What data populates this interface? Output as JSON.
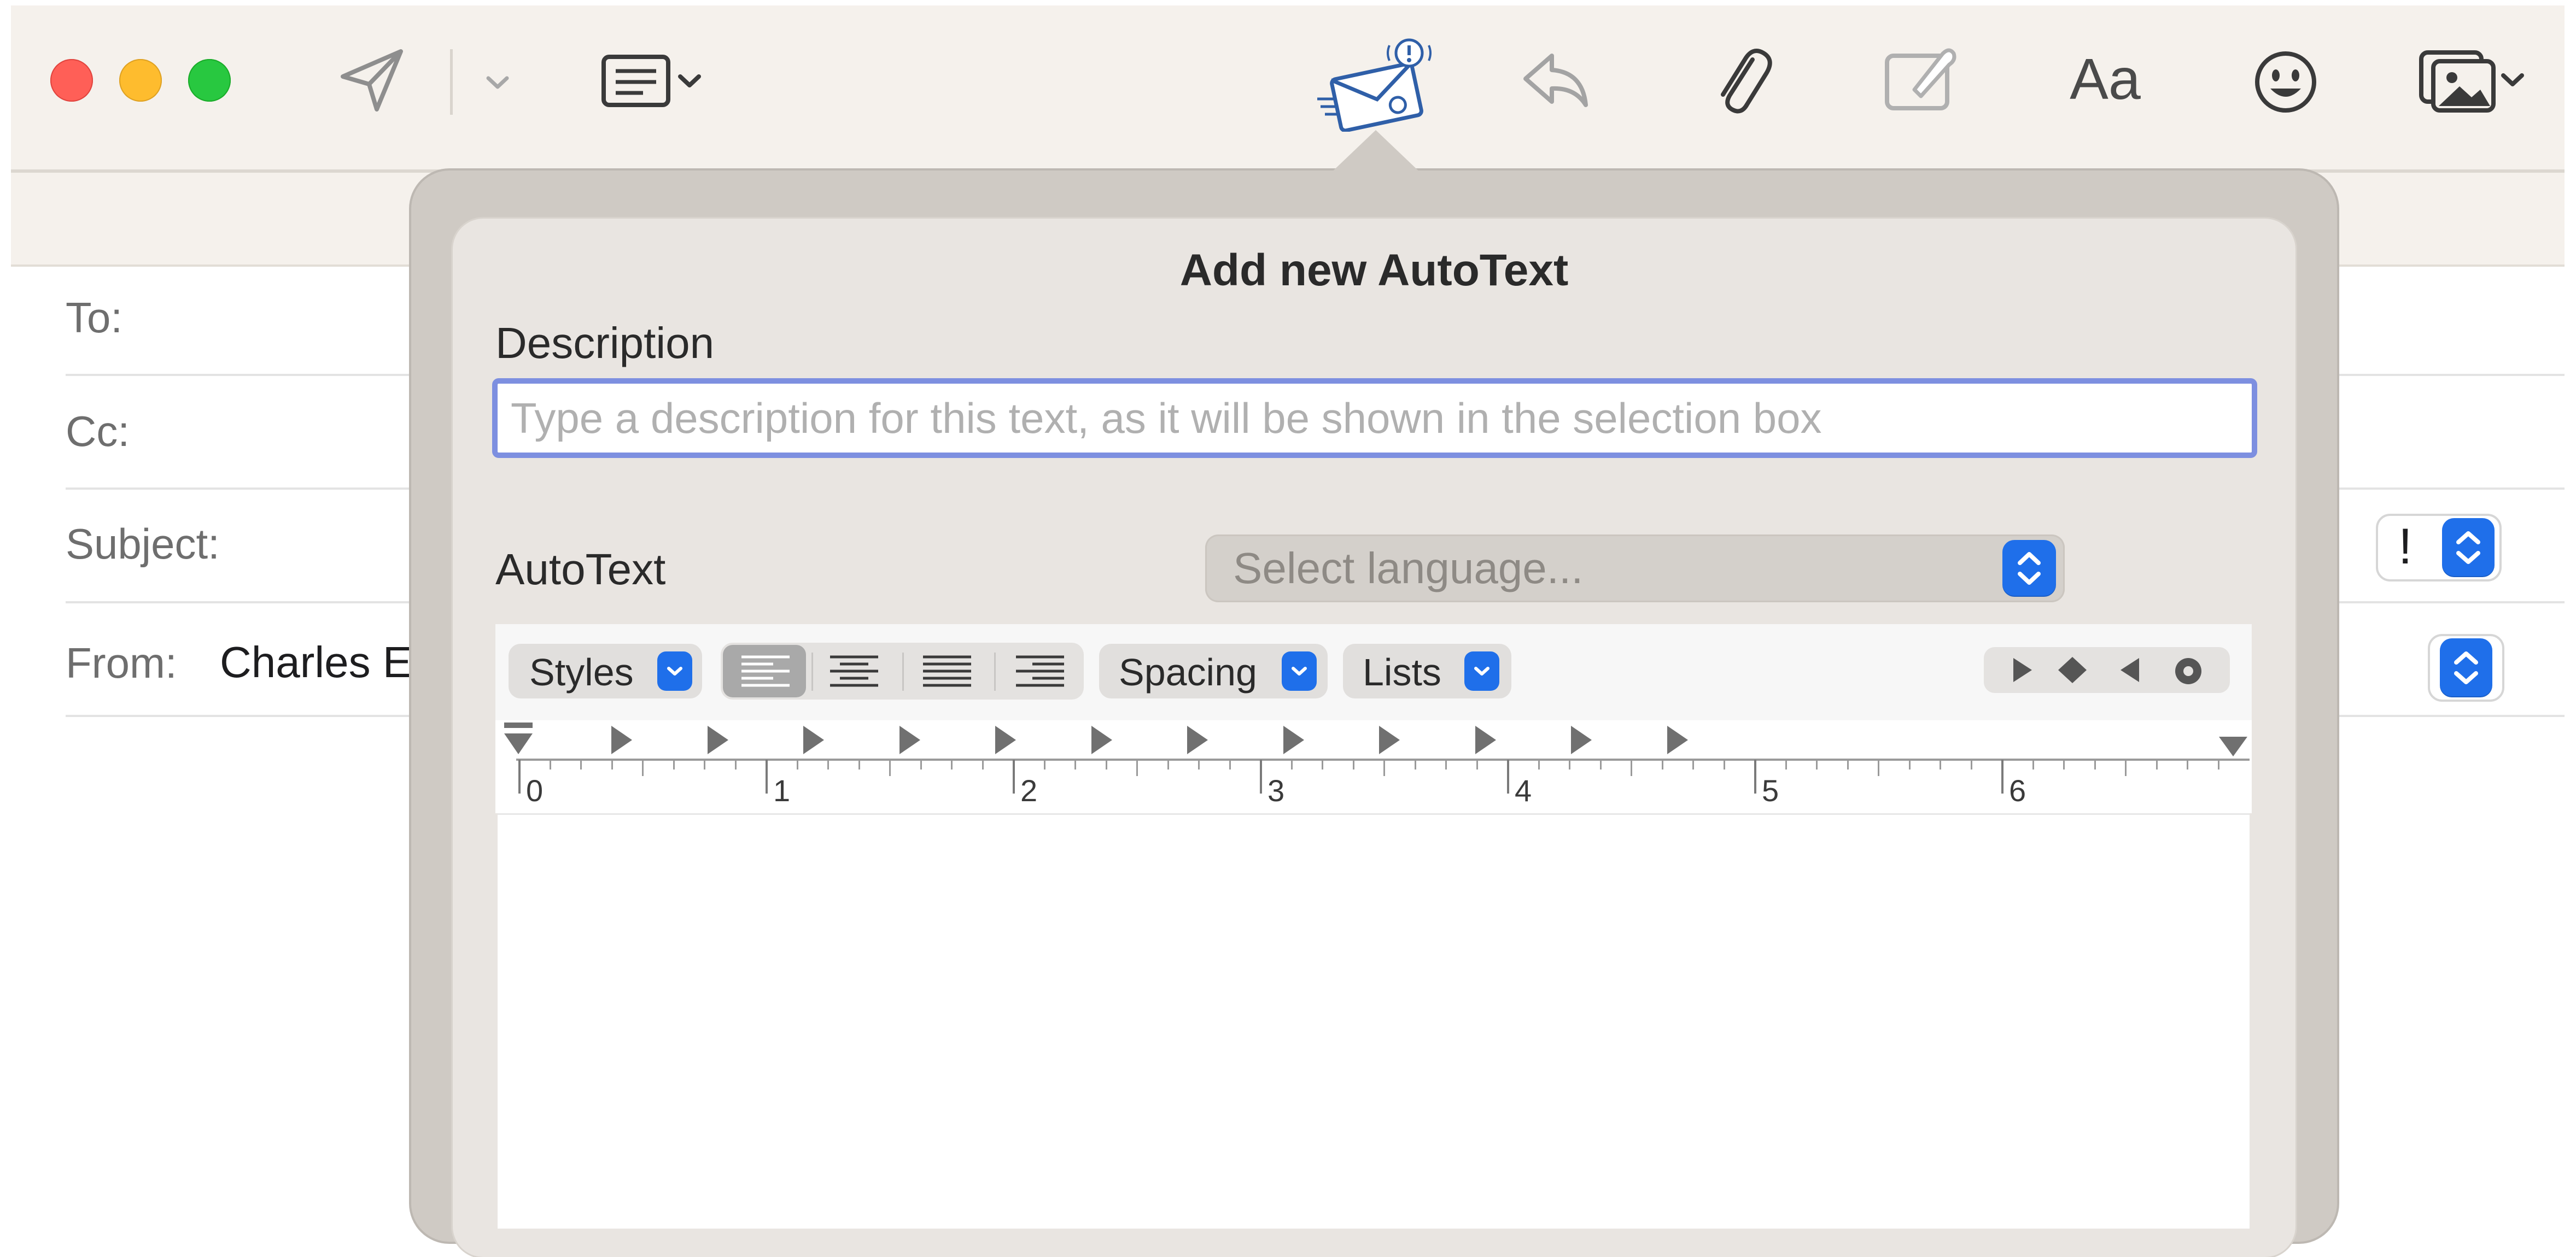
{
  "icons": {
    "send": "send-icon",
    "chevron": "chevron-down-icon",
    "header_fields": "header-fields-icon",
    "priority_mail": "priority-mail-icon",
    "reply": "reply-icon",
    "attach": "paperclip-icon",
    "markup": "markup-icon",
    "emoji": "emoji-icon",
    "photo": "photo-browser-icon"
  },
  "toolbar": {
    "format_label": "Aa"
  },
  "compose": {
    "to_label": "To:",
    "cc_label": "Cc:",
    "subject_label": "Subject:",
    "from_label": "From:",
    "from_value": "Charles E",
    "priority_value": "!"
  },
  "popover": {
    "title": "Add new AutoText",
    "description_label": "Description",
    "description_placeholder": "Type a description for this text, as it will be shown in the selection box",
    "description_value": "",
    "autotext_label": "AutoText",
    "language_placeholder": "Select language...",
    "editor": {
      "styles_label": "Styles",
      "spacing_label": "Spacing",
      "lists_label": "Lists",
      "ruler_numbers": [
        "0",
        "1",
        "2",
        "3",
        "4",
        "5",
        "6"
      ]
    }
  },
  "colors": {
    "accent": "#1f6fea",
    "focus_ring": "#7d8fe0",
    "close": "#ff5f57",
    "minimize": "#febc2e",
    "zoom": "#28c840"
  }
}
